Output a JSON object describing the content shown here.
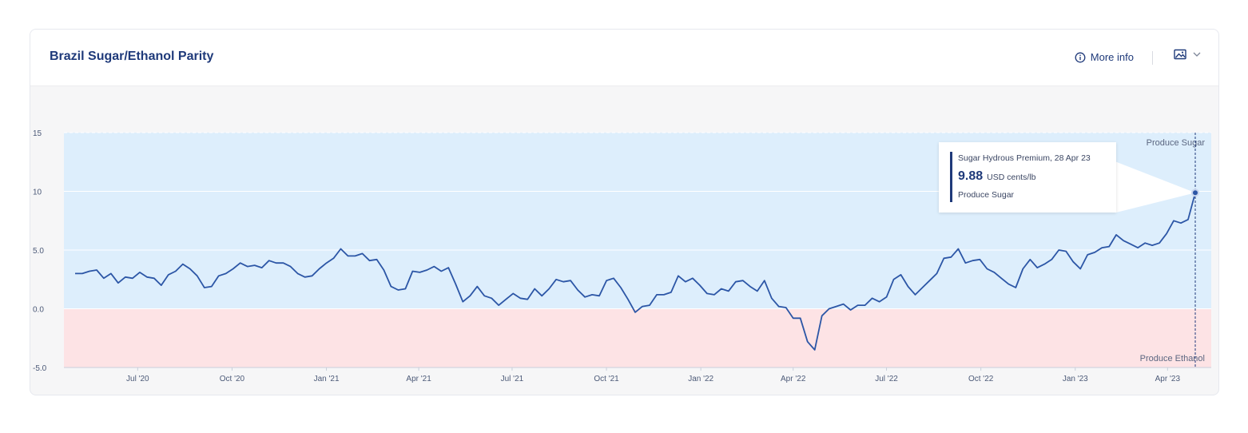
{
  "card": {
    "title": "Brazil Sugar/Ethanol Parity",
    "more_info_label": "More info",
    "info_icon": "info-circle-icon",
    "export_icon": "image-icon",
    "export_chevron_icon": "chevron-down-icon"
  },
  "colors": {
    "line": "#2c56a6",
    "positive_zone": "#ddeefc",
    "negative_zone": "#fde3e5",
    "title": "#1f3a7a"
  },
  "tooltip": {
    "series_date": "Sugar Hydrous Premium, 28 Apr 23",
    "value": "9.88",
    "unit": "USD cents/lb",
    "zone": "Produce Sugar"
  },
  "chart_data": {
    "type": "line",
    "title": "Brazil Sugar/Ethanol Parity",
    "xlabel": "",
    "ylabel": "",
    "ylim": [
      -5,
      15
    ],
    "y_ticks": [
      "15",
      "10",
      "5.0",
      "0.0",
      "-5.0"
    ],
    "x_ticks": [
      "Jul '20",
      "Oct '20",
      "Jan '21",
      "Apr '21",
      "Jul '21",
      "Oct '21",
      "Jan '22",
      "Apr '22",
      "Jul '22",
      "Oct '22",
      "Jan '23",
      "Apr '23"
    ],
    "x_range": [
      "2020-05-01",
      "2023-04-28"
    ],
    "zones": [
      {
        "label": "Produce Sugar",
        "from": 0,
        "to": 15
      },
      {
        "label": "Produce Ethanol",
        "from": -5,
        "to": 0
      }
    ],
    "series": [
      {
        "name": "Sugar Hydrous Premium",
        "unit": "USD cents/lb",
        "points": [
          [
            "2020-05-01",
            3.0
          ],
          [
            "2020-05-08",
            3.0
          ],
          [
            "2020-05-15",
            3.2
          ],
          [
            "2020-05-22",
            3.3
          ],
          [
            "2020-05-29",
            2.6
          ],
          [
            "2020-06-05",
            3.0
          ],
          [
            "2020-06-12",
            2.2
          ],
          [
            "2020-06-19",
            2.7
          ],
          [
            "2020-06-26",
            2.6
          ],
          [
            "2020-07-03",
            3.1
          ],
          [
            "2020-07-10",
            2.7
          ],
          [
            "2020-07-17",
            2.6
          ],
          [
            "2020-07-24",
            2.0
          ],
          [
            "2020-07-31",
            2.9
          ],
          [
            "2020-08-07",
            3.2
          ],
          [
            "2020-08-14",
            3.8
          ],
          [
            "2020-08-21",
            3.4
          ],
          [
            "2020-08-28",
            2.8
          ],
          [
            "2020-09-04",
            1.8
          ],
          [
            "2020-09-11",
            1.9
          ],
          [
            "2020-09-18",
            2.8
          ],
          [
            "2020-09-25",
            3.0
          ],
          [
            "2020-10-02",
            3.4
          ],
          [
            "2020-10-09",
            3.9
          ],
          [
            "2020-10-16",
            3.6
          ],
          [
            "2020-10-23",
            3.7
          ],
          [
            "2020-10-30",
            3.5
          ],
          [
            "2020-11-06",
            4.1
          ],
          [
            "2020-11-13",
            3.9
          ],
          [
            "2020-11-20",
            3.9
          ],
          [
            "2020-11-27",
            3.6
          ],
          [
            "2020-12-04",
            3.0
          ],
          [
            "2020-12-11",
            2.7
          ],
          [
            "2020-12-18",
            2.8
          ],
          [
            "2020-12-25",
            3.4
          ],
          [
            "2021-01-01",
            3.9
          ],
          [
            "2021-01-08",
            4.3
          ],
          [
            "2021-01-15",
            5.1
          ],
          [
            "2021-01-22",
            4.5
          ],
          [
            "2021-01-29",
            4.5
          ],
          [
            "2021-02-05",
            4.7
          ],
          [
            "2021-02-12",
            4.1
          ],
          [
            "2021-02-19",
            4.2
          ],
          [
            "2021-02-26",
            3.3
          ],
          [
            "2021-03-05",
            1.9
          ],
          [
            "2021-03-12",
            1.6
          ],
          [
            "2021-03-19",
            1.7
          ],
          [
            "2021-03-26",
            3.2
          ],
          [
            "2021-04-02",
            3.1
          ],
          [
            "2021-04-09",
            3.3
          ],
          [
            "2021-04-16",
            3.6
          ],
          [
            "2021-04-23",
            3.2
          ],
          [
            "2021-04-30",
            3.5
          ],
          [
            "2021-05-07",
            2.1
          ],
          [
            "2021-05-14",
            0.6
          ],
          [
            "2021-05-21",
            1.1
          ],
          [
            "2021-05-28",
            1.9
          ],
          [
            "2021-06-04",
            1.1
          ],
          [
            "2021-06-11",
            0.9
          ],
          [
            "2021-06-18",
            0.3
          ],
          [
            "2021-06-25",
            0.8
          ],
          [
            "2021-07-02",
            1.3
          ],
          [
            "2021-07-09",
            0.9
          ],
          [
            "2021-07-16",
            0.8
          ],
          [
            "2021-07-23",
            1.7
          ],
          [
            "2021-07-30",
            1.1
          ],
          [
            "2021-08-06",
            1.7
          ],
          [
            "2021-08-13",
            2.5
          ],
          [
            "2021-08-20",
            2.3
          ],
          [
            "2021-08-27",
            2.4
          ],
          [
            "2021-09-03",
            1.6
          ],
          [
            "2021-09-10",
            1.0
          ],
          [
            "2021-09-17",
            1.2
          ],
          [
            "2021-09-24",
            1.1
          ],
          [
            "2021-10-01",
            2.4
          ],
          [
            "2021-10-08",
            2.6
          ],
          [
            "2021-10-15",
            1.8
          ],
          [
            "2021-10-22",
            0.8
          ],
          [
            "2021-10-29",
            -0.3
          ],
          [
            "2021-11-05",
            0.2
          ],
          [
            "2021-11-12",
            0.3
          ],
          [
            "2021-11-19",
            1.2
          ],
          [
            "2021-11-26",
            1.2
          ],
          [
            "2021-12-03",
            1.4
          ],
          [
            "2021-12-10",
            2.8
          ],
          [
            "2021-12-17",
            2.3
          ],
          [
            "2021-12-24",
            2.6
          ],
          [
            "2021-12-31",
            2.0
          ],
          [
            "2022-01-07",
            1.3
          ],
          [
            "2022-01-14",
            1.2
          ],
          [
            "2022-01-21",
            1.7
          ],
          [
            "2022-01-28",
            1.5
          ],
          [
            "2022-02-04",
            2.3
          ],
          [
            "2022-02-11",
            2.4
          ],
          [
            "2022-02-18",
            1.9
          ],
          [
            "2022-02-25",
            1.5
          ],
          [
            "2022-03-04",
            2.4
          ],
          [
            "2022-03-11",
            0.9
          ],
          [
            "2022-03-18",
            0.2
          ],
          [
            "2022-03-25",
            0.1
          ],
          [
            "2022-04-01",
            -0.8
          ],
          [
            "2022-04-08",
            -0.8
          ],
          [
            "2022-04-15",
            -2.8
          ],
          [
            "2022-04-22",
            -3.5
          ],
          [
            "2022-04-29",
            -0.6
          ],
          [
            "2022-05-06",
            0.0
          ],
          [
            "2022-05-13",
            0.2
          ],
          [
            "2022-05-20",
            0.4
          ],
          [
            "2022-05-27",
            -0.1
          ],
          [
            "2022-06-03",
            0.3
          ],
          [
            "2022-06-10",
            0.3
          ],
          [
            "2022-06-17",
            0.9
          ],
          [
            "2022-06-24",
            0.6
          ],
          [
            "2022-07-01",
            1.0
          ],
          [
            "2022-07-08",
            2.5
          ],
          [
            "2022-07-15",
            2.9
          ],
          [
            "2022-07-22",
            1.9
          ],
          [
            "2022-07-29",
            1.2
          ],
          [
            "2022-08-05",
            1.8
          ],
          [
            "2022-08-12",
            2.4
          ],
          [
            "2022-08-19",
            3.0
          ],
          [
            "2022-08-26",
            4.3
          ],
          [
            "2022-09-02",
            4.4
          ],
          [
            "2022-09-09",
            5.1
          ],
          [
            "2022-09-16",
            3.9
          ],
          [
            "2022-09-23",
            4.1
          ],
          [
            "2022-09-30",
            4.2
          ],
          [
            "2022-10-07",
            3.4
          ],
          [
            "2022-10-14",
            3.1
          ],
          [
            "2022-10-21",
            2.6
          ],
          [
            "2022-10-28",
            2.1
          ],
          [
            "2022-11-04",
            1.8
          ],
          [
            "2022-11-11",
            3.4
          ],
          [
            "2022-11-18",
            4.2
          ],
          [
            "2022-11-25",
            3.5
          ],
          [
            "2022-12-02",
            3.8
          ],
          [
            "2022-12-09",
            4.2
          ],
          [
            "2022-12-16",
            5.0
          ],
          [
            "2022-12-23",
            4.9
          ],
          [
            "2022-12-30",
            4.0
          ],
          [
            "2023-01-06",
            3.4
          ],
          [
            "2023-01-13",
            4.6
          ],
          [
            "2023-01-20",
            4.8
          ],
          [
            "2023-01-27",
            5.2
          ],
          [
            "2023-02-03",
            5.3
          ],
          [
            "2023-02-10",
            6.3
          ],
          [
            "2023-02-17",
            5.8
          ],
          [
            "2023-02-24",
            5.5
          ],
          [
            "2023-03-03",
            5.2
          ],
          [
            "2023-03-10",
            5.6
          ],
          [
            "2023-03-17",
            5.4
          ],
          [
            "2023-03-24",
            5.6
          ],
          [
            "2023-03-31",
            6.4
          ],
          [
            "2023-04-07",
            7.5
          ],
          [
            "2023-04-14",
            7.3
          ],
          [
            "2023-04-21",
            7.6
          ],
          [
            "2023-04-28",
            9.88
          ]
        ]
      }
    ]
  }
}
